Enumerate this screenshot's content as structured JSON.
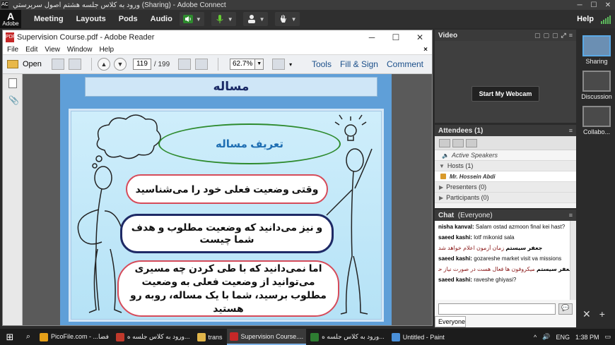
{
  "window": {
    "title": "ورود به کلاس جلسه هشتم اصول سرپرستي (Sharing) - Adobe Connect",
    "logo_text": "AC"
  },
  "connect_bar": {
    "logo_letter": "A",
    "logo_text": "Adobe",
    "menus": [
      "Meeting",
      "Layouts",
      "Pods",
      "Audio"
    ],
    "help": "Help"
  },
  "reader": {
    "title": "Supervision Course.pdf - Adobe Reader",
    "menu": [
      "File",
      "Edit",
      "View",
      "Window",
      "Help"
    ],
    "open_label": "Open",
    "page_current": "119",
    "page_total": "/ 199",
    "zoom": "62.7%",
    "tools": "Tools",
    "fill_sign": "Fill & Sign",
    "comment": "Comment"
  },
  "slide": {
    "heading": "مساله",
    "title_bubble": "تعریف مساله",
    "bubble1": "وقتی وضعیت فعلی خود را می‌شناسید",
    "bubble2": "و نیز می‌دانید که وضعیت مطلوب و هدف شما چیست",
    "bubble3": "اما نمی‌دانید که با طی کردن چه مسیری می‌توانید از وضعیت فعلی به وضعیت مطلوب برسید، شما با یک مساله، روبه رو هستید"
  },
  "video": {
    "title": "Video",
    "start_webcam": "Start My Webcam"
  },
  "attendees": {
    "title": "Attendees",
    "count": "(1)",
    "active_speakers": "Active Speakers",
    "hosts": "Hosts (1)",
    "host_name": "Mr. Hossein Abdi",
    "presenters": "Presenters (0)",
    "participants": "Participants (0)"
  },
  "chat": {
    "title": "Chat",
    "scope": "(Everyone)",
    "messages": [
      {
        "user": "nisha kanval:",
        "text": "Salam ostad azmoon final kei hast?"
      },
      {
        "user": "saeed kashi:",
        "text": "lotf mikonid  sala"
      },
      {
        "user": "",
        "text": "زمان آزمون اعلام خواهد شد",
        "rtl": true,
        "sender": "جعفر سیستم"
      },
      {
        "user": "saeed kashi:",
        "text": "gozareshe market visit va missions"
      },
      {
        "user": "",
        "text": "میکروفون ها فعال هست در صورت نیاز حتما صحبت کنید",
        "rtl": true,
        "sender": "جعفر سیستم"
      },
      {
        "user": "saeed kashi:",
        "text": "raveshe ghiyasi?"
      }
    ],
    "tab": "Everyone"
  },
  "layouts": {
    "items": [
      "Sharing",
      "Discussion",
      "Collabo..."
    ]
  },
  "taskbar": {
    "apps": [
      {
        "label": "PicoFile.com - ...فضا",
        "color": "#e5a019"
      },
      {
        "label": "ورود به کلاس جلسه ه...",
        "color": "#c0392b"
      },
      {
        "label": "trans",
        "color": "#e1b54a"
      },
      {
        "label": "Supervision Course....",
        "color": "#c62828"
      },
      {
        "label": "ورود به کلاس جلسه ه...",
        "color": "#2e7d32"
      },
      {
        "label": "Untitled - Paint",
        "color": "#4a90d9"
      }
    ],
    "lang": "ENG",
    "time": "1:38 PM"
  },
  "colors": {
    "accent": "#5aa9e6",
    "slide_bg": "#5f9fd8",
    "heading_text": "#1b2a66"
  }
}
